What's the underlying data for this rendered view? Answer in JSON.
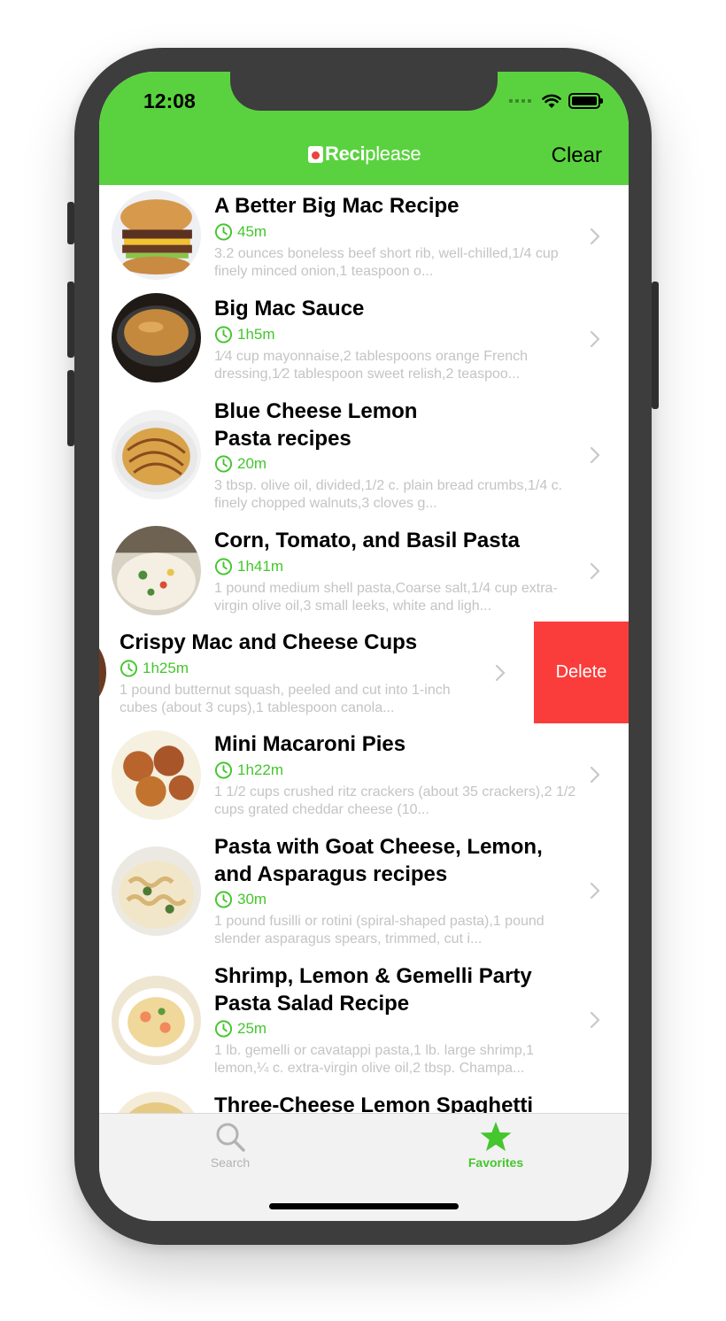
{
  "status_bar": {
    "time": "12:08"
  },
  "header": {
    "brand_bold": "Reci",
    "brand_rest": "please",
    "clear_label": "Clear"
  },
  "recipes": [
    {
      "title": "A Better Big Mac Recipe",
      "time": "45m",
      "ingredients": "3.2 ounces boneless beef short rib, well-chilled,1/4 cup finely minced onion,1 teaspoon o..."
    },
    {
      "title": "Big Mac Sauce",
      "time": "1h5m",
      "ingredients": "1⁄4 cup mayonnaise,2  tablespoons orange French dressing,1⁄2 tablespoon sweet relish,2  teaspoo..."
    },
    {
      "title": "Blue Cheese Lemon Pasta recipes",
      "time": "20m",
      "ingredients": "3 tbsp. olive oil, divided,1/2 c. plain bread crumbs,1/4 c. finely chopped walnuts,3 cloves g..."
    },
    {
      "title": "Corn, Tomato, and Basil Pasta",
      "time": "1h41m",
      "ingredients": "1 pound medium shell pasta,Coarse salt,1/4 cup extra-virgin olive oil,3 small leeks, white and ligh..."
    },
    {
      "title": "Crispy Mac and Cheese Cups",
      "time": "1h25m",
      "ingredients": "1 pound butternut squash, peeled and cut into 1-inch cubes (about 3 cups),1 tablespoon canola..."
    },
    {
      "title": "Mini Macaroni Pies",
      "time": "1h22m",
      "ingredients": "1 1/2 cups crushed ritz crackers (about 35 crackers),2 1/2 cups grated cheddar cheese (10..."
    },
    {
      "title": "Pasta with Goat Cheese, Lemon, and Asparagus recipes",
      "time": "30m",
      "ingredients": "1 pound fusilli or rotini (spiral-shaped pasta),1 pound slender asparagus spears, trimmed, cut i..."
    },
    {
      "title": "Shrimp, Lemon & Gemelli Party Pasta Salad Recipe",
      "time": "25m",
      "ingredients": "1 lb. gemelli or cavatappi pasta,1 lb. large shrimp,1 lemon,¼ c. extra-virgin olive oil,2 tbsp. Champa..."
    },
    {
      "title": "Three-Cheese Lemon Spaghetti"
    }
  ],
  "swipe_action": {
    "label": "Delete"
  },
  "tabs": {
    "search": {
      "label": "Search",
      "icon": "search-icon"
    },
    "favorites": {
      "label": "Favorites",
      "icon": "star-icon",
      "selected": true
    }
  },
  "colors": {
    "brand_green": "#5ad23f",
    "time_green": "#44c62d",
    "delete_red": "#fa3d3b"
  }
}
